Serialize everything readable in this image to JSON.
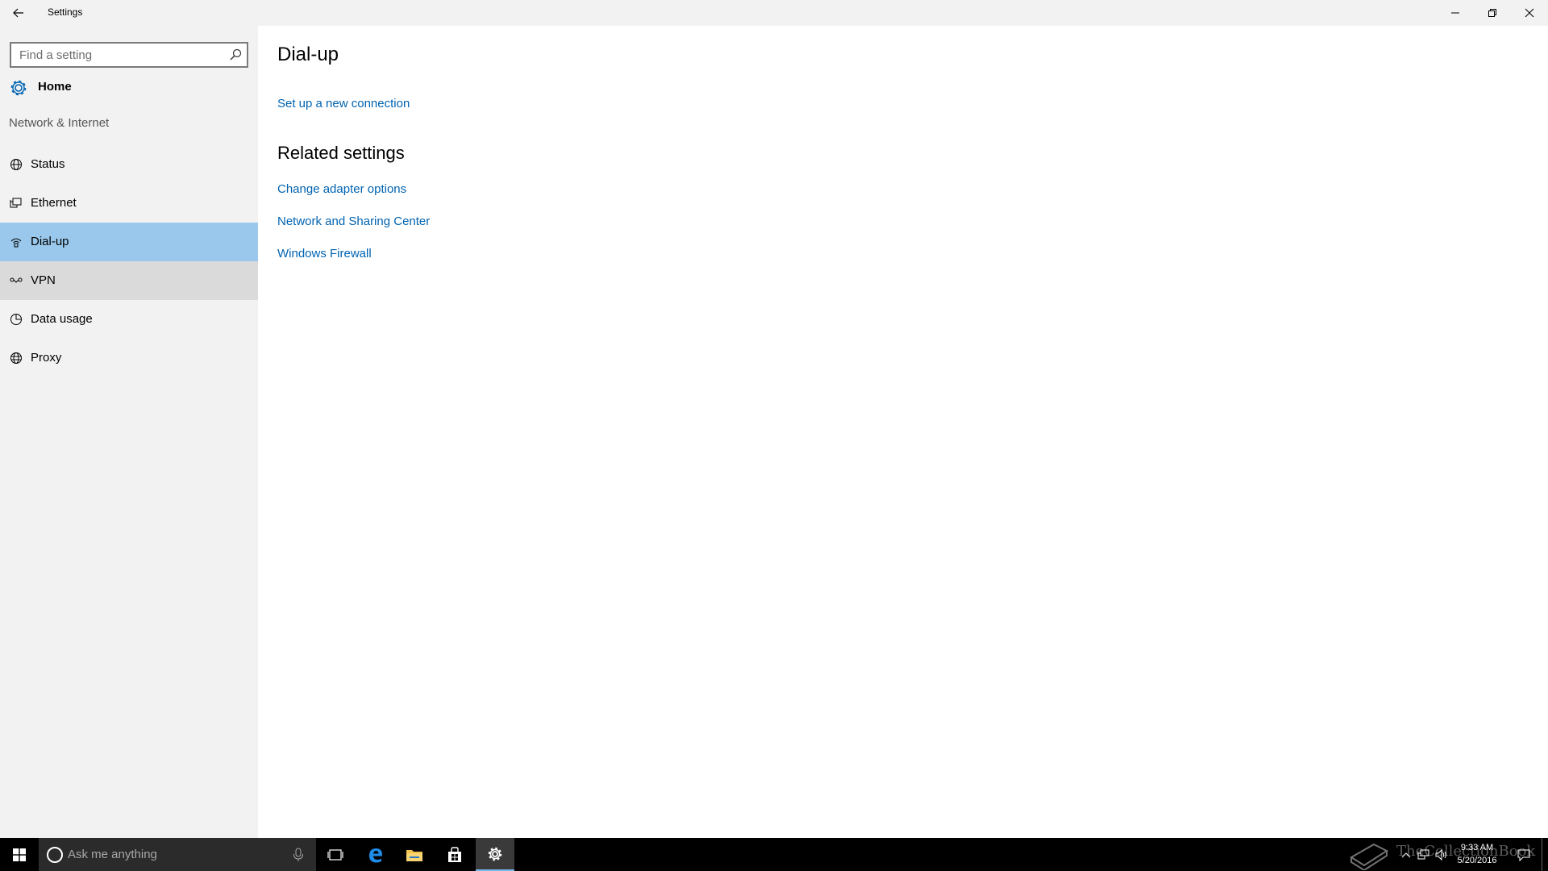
{
  "window": {
    "title": "Settings",
    "controls": {
      "minimize": "minimize",
      "maximize": "restore",
      "close": "close"
    }
  },
  "sidebar": {
    "search_placeholder": "Find a setting",
    "home_label": "Home",
    "section_label": "Network & Internet",
    "items": [
      {
        "label": "Status",
        "icon": "status-globe-icon",
        "state": "normal"
      },
      {
        "label": "Ethernet",
        "icon": "ethernet-icon",
        "state": "normal"
      },
      {
        "label": "Dial-up",
        "icon": "dialup-icon",
        "state": "selected"
      },
      {
        "label": "VPN",
        "icon": "vpn-icon",
        "state": "hover"
      },
      {
        "label": "Data usage",
        "icon": "data-usage-icon",
        "state": "normal"
      },
      {
        "label": "Proxy",
        "icon": "proxy-globe-icon",
        "state": "normal"
      }
    ]
  },
  "main": {
    "title": "Dial-up",
    "setup_link": "Set up a new connection",
    "related_title": "Related settings",
    "related_links": [
      "Change adapter options",
      "Network and Sharing Center",
      "Windows Firewall"
    ]
  },
  "taskbar": {
    "search_placeholder": "Ask me anything",
    "clock_time": "9:33 AM",
    "clock_date": "5/20/2016",
    "watermark": "TheCollectionBook"
  },
  "colors": {
    "accent_link": "#0063b1",
    "selected_bg": "#99c8ec",
    "hover_bg": "#dadada",
    "sidebar_bg": "#f2f2f2",
    "taskbar_bg": "#000000"
  }
}
